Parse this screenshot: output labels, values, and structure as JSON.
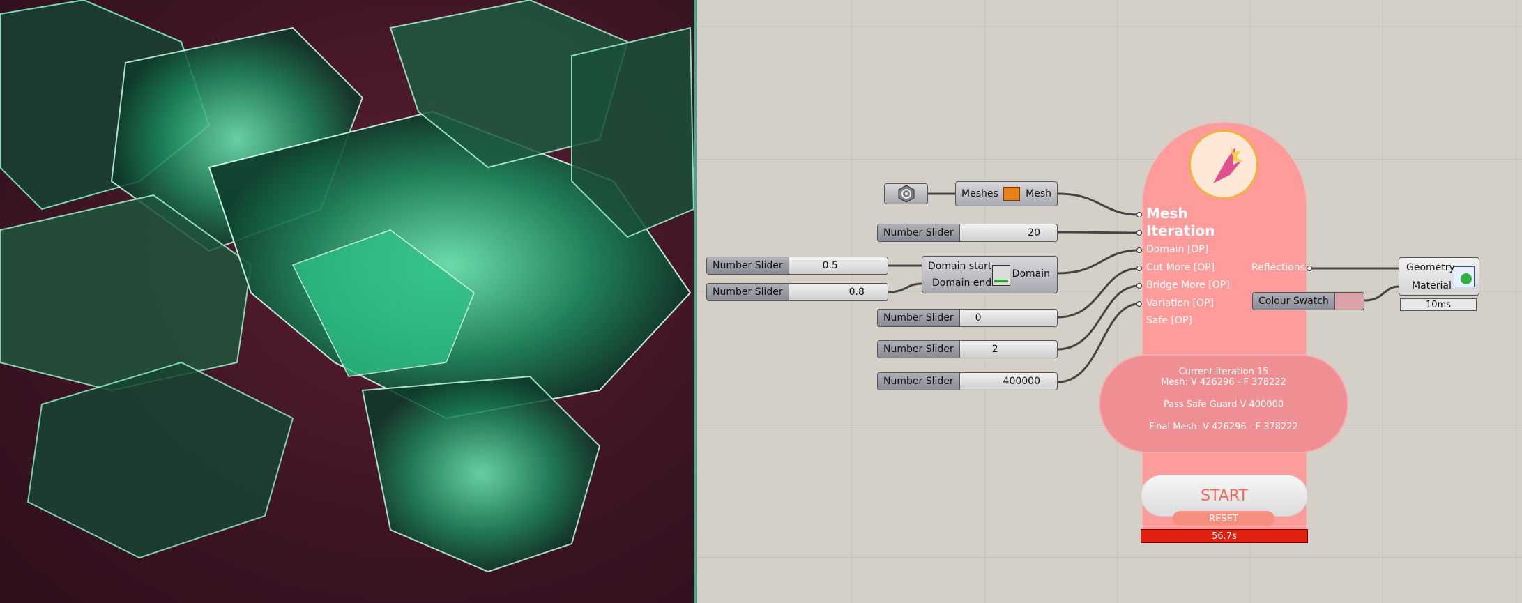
{
  "viewport": {
    "description_icon": "mesh-render-view"
  },
  "components": {
    "param_icon": "param-hex-icon",
    "meshes": {
      "input": "Meshes",
      "output": "Mesh",
      "icon": "mesh-convert-icon"
    },
    "domain": {
      "input_start": "Domain start",
      "input_end": "Domain end",
      "output": "Domain",
      "icon": "construct-domain-icon"
    }
  },
  "sliders": [
    {
      "label": "Number Slider",
      "value": "20"
    },
    {
      "label": "Number Slider",
      "value": "0.5"
    },
    {
      "label": "Number Slider",
      "value": "0.8"
    },
    {
      "label": "Number Slider",
      "value": "0"
    },
    {
      "label": "Number Slider",
      "value": "2"
    },
    {
      "label": "Number Slider",
      "value": "400000"
    }
  ],
  "mesh_iteration": {
    "title_line1": "Mesh",
    "title_line2": "Iteration",
    "inputs": [
      "Domain [OP]",
      "Cut More [OP]",
      "Bridge More [OP]",
      "Variation [OP]",
      "Safe [OP]"
    ],
    "output": "Reflections",
    "info_line1": "Current Iteration 15",
    "info_line2": "Mesh: V 426296 - F 378222",
    "info_line3": "Pass Safe Guard V 400000",
    "info_line4": "Final Mesh: V 426296 - F 378222",
    "start_label": "START",
    "reset_label": "RESET",
    "timer": "56.7s",
    "logo_icon": "flower-logo-icon"
  },
  "colour_swatch": {
    "label": "Colour Swatch",
    "color": "#d9a3a8"
  },
  "preview": {
    "input1": "Geometry",
    "input2": "Material",
    "timer": "10ms",
    "icon": "custom-preview-icon"
  },
  "colors": {
    "pink_body": "#fe9b9b",
    "pink_info": "#f08f93",
    "timer_red": "#e02010",
    "wire": "#444444"
  }
}
